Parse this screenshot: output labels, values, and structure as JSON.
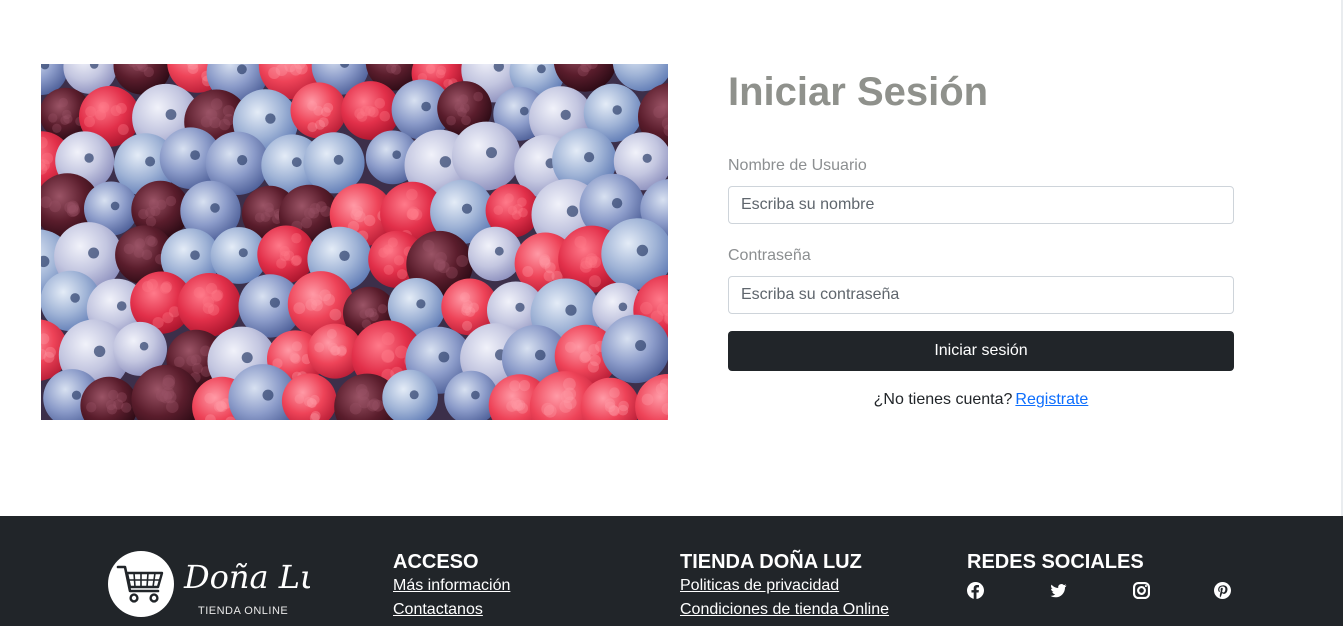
{
  "hero": {
    "image": "mixed-berries-photo"
  },
  "login": {
    "title": "Iniciar Sesión",
    "username_label": "Nombre de Usuario",
    "username_placeholder": "Escriba su nombre",
    "password_label": "Contraseña",
    "password_placeholder": "Escriba su contraseña",
    "submit_label": "Iniciar sesión",
    "no_account_text": "¿No tienes cuenta?",
    "register_link": "Registrate"
  },
  "footer": {
    "brand": {
      "script_name": "Doña Luz",
      "subtitle": "TIENDA ONLINE",
      "logo_icon": "shopping-cart-icon"
    },
    "acceso": {
      "heading": "ACCESO",
      "links": [
        "Más información",
        "Contactanos"
      ]
    },
    "tienda": {
      "heading": "TIENDA DOÑA LUZ",
      "links": [
        "Politicas de privacidad",
        "Condiciones de tienda Online"
      ]
    },
    "redes": {
      "heading": "REDES SOCIALES",
      "icons": [
        "facebook-icon",
        "twitter-icon",
        "instagram-icon",
        "pinterest-icon"
      ]
    }
  },
  "colors": {
    "footer_bg": "#212529",
    "button_bg": "#212529",
    "title": "#8f918c",
    "link": "#0d6efd"
  }
}
